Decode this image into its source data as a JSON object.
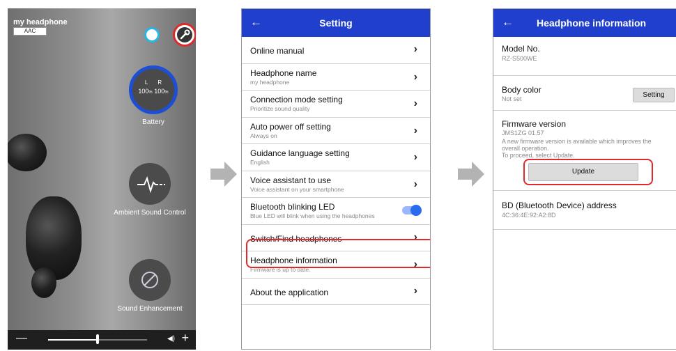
{
  "home": {
    "device_name": "my headphone",
    "codec": "AAC",
    "battery": {
      "left_label": "L",
      "right_label": "R",
      "left_value": "100",
      "right_value": "100",
      "unit": "%",
      "caption": "Battery"
    },
    "ambient_caption": "Ambient Sound Control",
    "enhancement_caption": "Sound Enhancement",
    "volume_level": 0.5
  },
  "settings": {
    "title": "Setting",
    "items": [
      {
        "label": "Online manual",
        "sub": ""
      },
      {
        "label": "Headphone name",
        "sub": "my headphone"
      },
      {
        "label": "Connection mode setting",
        "sub": "Prioritize sound quality"
      },
      {
        "label": "Auto power off setting",
        "sub": "Always on"
      },
      {
        "label": "Guidance language setting",
        "sub": "English"
      },
      {
        "label": "Voice assistant to use",
        "sub": "Voice assistant on your smartphone"
      },
      {
        "label": "Bluetooth blinking LED",
        "sub": "Blue LED will blink when using the headphones"
      },
      {
        "label": "Switch/Find headphones",
        "sub": ""
      },
      {
        "label": "Headphone information",
        "sub": "Firmware is up to date."
      },
      {
        "label": "About the application",
        "sub": ""
      }
    ]
  },
  "info": {
    "title": "Headphone information",
    "model_label": "Model No.",
    "model_value": "RZ-S500WE",
    "color_label": "Body color",
    "color_value": "Not set",
    "color_button": "Setting",
    "fw_label": "Firmware version",
    "fw_value": "JMS1ZG 01.57",
    "fw_desc_1": "A new firmware version is available which improves the",
    "fw_desc_2": "overall operation.",
    "fw_desc_3": "To proceed, select Update.",
    "update_button": "Update",
    "bd_label": "BD (Bluetooth Device) address",
    "bd_value": "4C:36:4E:92:A2:8D"
  },
  "colors": {
    "appbar": "#1f3fcc",
    "highlight": "#e02a2a",
    "toggle": "#2a6cf0"
  }
}
